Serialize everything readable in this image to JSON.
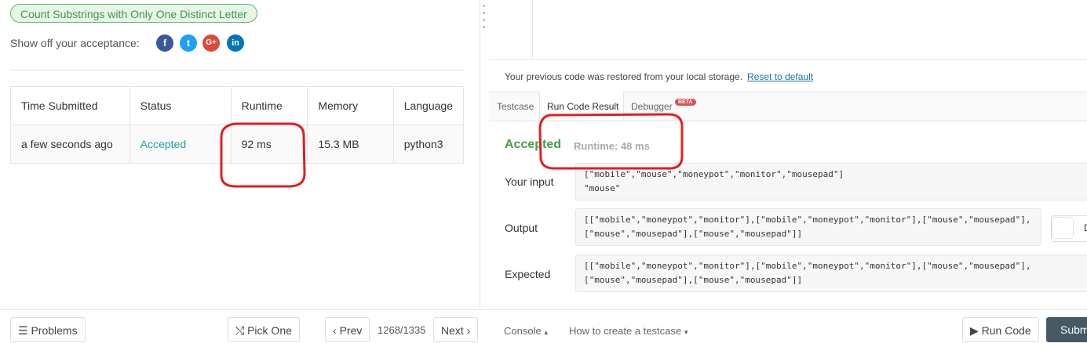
{
  "problem": {
    "title": "Count Substrings with Only One Distinct Letter"
  },
  "share": {
    "label": "Show off your acceptance:",
    "icons": [
      "facebook-icon",
      "twitter-icon",
      "googleplus-icon",
      "linkedin-icon"
    ],
    "glyphs": [
      "f",
      "t",
      "G+",
      "in"
    ]
  },
  "submissions": {
    "headers": [
      "Time Submitted",
      "Status",
      "Runtime",
      "Memory",
      "Language"
    ],
    "rows": [
      [
        "a few seconds ago",
        "Accepted",
        "92 ms",
        "15.3 MB",
        "python3"
      ]
    ]
  },
  "footer_left": {
    "problems_label": "Problems",
    "pick_one_label": "Pick One",
    "prev_label": "Prev",
    "page": "1268/1335",
    "next_label": "Next"
  },
  "restore": {
    "message": "Your previous code was restored from your local storage.",
    "reset_label": "Reset to default"
  },
  "tabs": [
    "Testcase",
    "Run Code Result",
    "Debugger"
  ],
  "beta_badge": "BETA",
  "result": {
    "status": "Accepted",
    "runtime": "Runtime: 48 ms",
    "input_label": "Your input",
    "input_value": "[\"mobile\",\"mouse\",\"moneypot\",\"monitor\",\"mousepad\"]\n\"mouse\"",
    "output_label": "Output",
    "output_value": "[[\"mobile\",\"moneypot\",\"monitor\"],[\"mobile\",\"moneypot\",\"monitor\"],[\"mouse\",\"mousepad\"],\n[\"mouse\",\"mousepad\"],[\"mouse\",\"mousepad\"]]",
    "expected_label": "Expected",
    "expected_value": "[[\"mobile\",\"moneypot\",\"monitor\"],[\"mobile\",\"moneypot\",\"monitor\"],[\"mouse\",\"mousepad\"],\n[\"mouse\",\"mousepad\"],[\"mouse\",\"mousepad\"]]",
    "diff_toggle_label": "D"
  },
  "footer_right": {
    "console_label": "Console",
    "howto_label": "How to create a testcase",
    "run_label": "Run Code",
    "submit_label": "Subm"
  },
  "colors": {
    "accepted": "#43a047",
    "link": "#1ba39c",
    "annotation": "#e02020"
  }
}
